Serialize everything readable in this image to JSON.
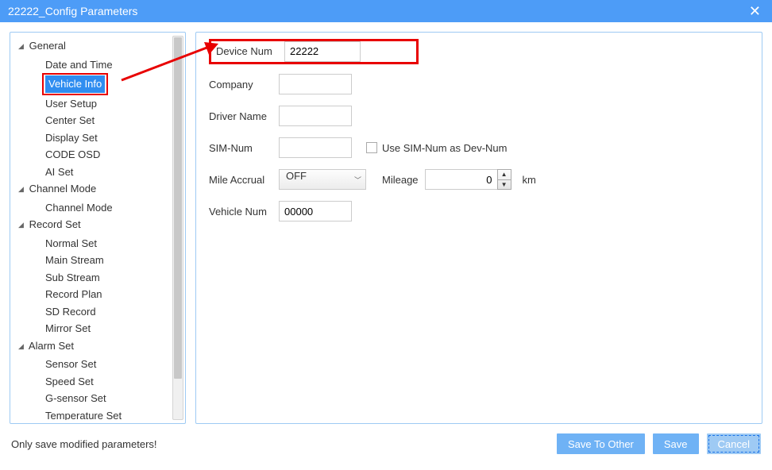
{
  "window": {
    "title": "22222_Config Parameters"
  },
  "tree": {
    "groups": [
      {
        "label": "General",
        "items": [
          "Date and Time",
          "Vehicle Info",
          "User Setup",
          "Center Set",
          "Display Set",
          "CODE OSD",
          "AI Set"
        ],
        "selectedIndex": 1
      },
      {
        "label": "Channel Mode",
        "items": [
          "Channel Mode"
        ]
      },
      {
        "label": "Record Set",
        "items": [
          "Normal Set",
          "Main Stream",
          "Sub Stream",
          "Record Plan",
          "SD Record",
          "Mirror Set"
        ]
      },
      {
        "label": "Alarm Set",
        "items": [
          "Sensor Set",
          "Speed Set",
          "G-sensor Set",
          "Temperature Set"
        ]
      }
    ]
  },
  "form": {
    "deviceNum": {
      "label": "Device Num",
      "value": "22222"
    },
    "company": {
      "label": "Company",
      "value": ""
    },
    "driverName": {
      "label": "Driver Name",
      "value": ""
    },
    "simNum": {
      "label": "SIM-Num",
      "value": "",
      "checkboxLabel": "Use SIM-Num as Dev-Num"
    },
    "mileAccrual": {
      "label": "Mile Accrual",
      "value": "OFF",
      "mileageLabel": "Mileage",
      "mileageValue": "0",
      "unit": "km"
    },
    "vehicleNum": {
      "label": "Vehicle Num",
      "value": "00000"
    }
  },
  "footer": {
    "status": "Only save modified parameters!",
    "saveToOther": "Save To Other",
    "save": "Save",
    "cancel": "Cancel"
  }
}
